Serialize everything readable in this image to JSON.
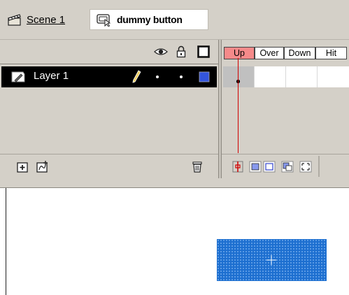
{
  "breadcrumb": {
    "scene_label": "Scene 1",
    "symbol_label": "dummy button"
  },
  "timeline": {
    "layers": [
      {
        "name": "Layer 1",
        "selected": true,
        "visible": true,
        "locked": false,
        "outline_color": "#3355dd"
      }
    ],
    "frame_labels": [
      "Up",
      "Over",
      "Down",
      "Hit"
    ],
    "current_frame_label": "Up"
  },
  "colors": {
    "panel_bg": "#d4d0c8",
    "selected_layer_bg": "#000000",
    "playhead": "#d00000",
    "current_frame_label_bg": "#f58a8a",
    "button_fill": "#1d6fd0"
  },
  "icons": {
    "scene": "scene-clapper-icon",
    "symbol": "button-symbol-icon",
    "eye": "eye-icon",
    "lock": "lock-icon",
    "outline": "outline-square-icon",
    "layer": "layer-page-icon",
    "pencil": "pencil-icon",
    "add_layer": "insert-layer-icon",
    "add_guide": "add-motion-guide-icon",
    "trash": "trash-icon",
    "center_frame": "center-frame-icon",
    "onion_skin": "onion-skin-icon",
    "onion_outlines": "onion-skin-outlines-icon",
    "edit_multiple": "edit-multiple-frames-icon",
    "modify_markers": "modify-onion-markers-icon"
  }
}
